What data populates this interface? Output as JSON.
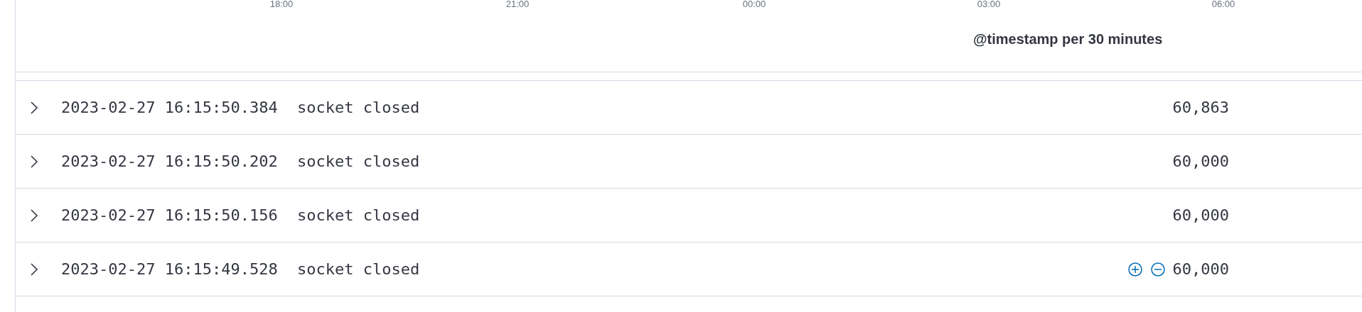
{
  "histogram": {
    "x_ticks": [
      "18:00",
      "21:00",
      "00:00",
      "03:00",
      "06:00"
    ],
    "x_title": "@timestamp per 30 minutes"
  },
  "table": {
    "rows": [
      {
        "expanded": false,
        "hovered": false,
        "timestamp": "2023-02-27 16:15:50.384",
        "message": "socket closed",
        "column_3": "60,863"
      },
      {
        "expanded": false,
        "hovered": false,
        "timestamp": "2023-02-27 16:15:50.202",
        "message": "socket closed",
        "column_3": "60,000"
      },
      {
        "expanded": false,
        "hovered": false,
        "timestamp": "2023-02-27 16:15:50.156",
        "message": "socket closed",
        "column_3": "60,000"
      },
      {
        "expanded": false,
        "hovered": true,
        "timestamp": "2023-02-27 16:15:49.528",
        "message": "socket closed",
        "column_3": "60,000"
      }
    ]
  }
}
